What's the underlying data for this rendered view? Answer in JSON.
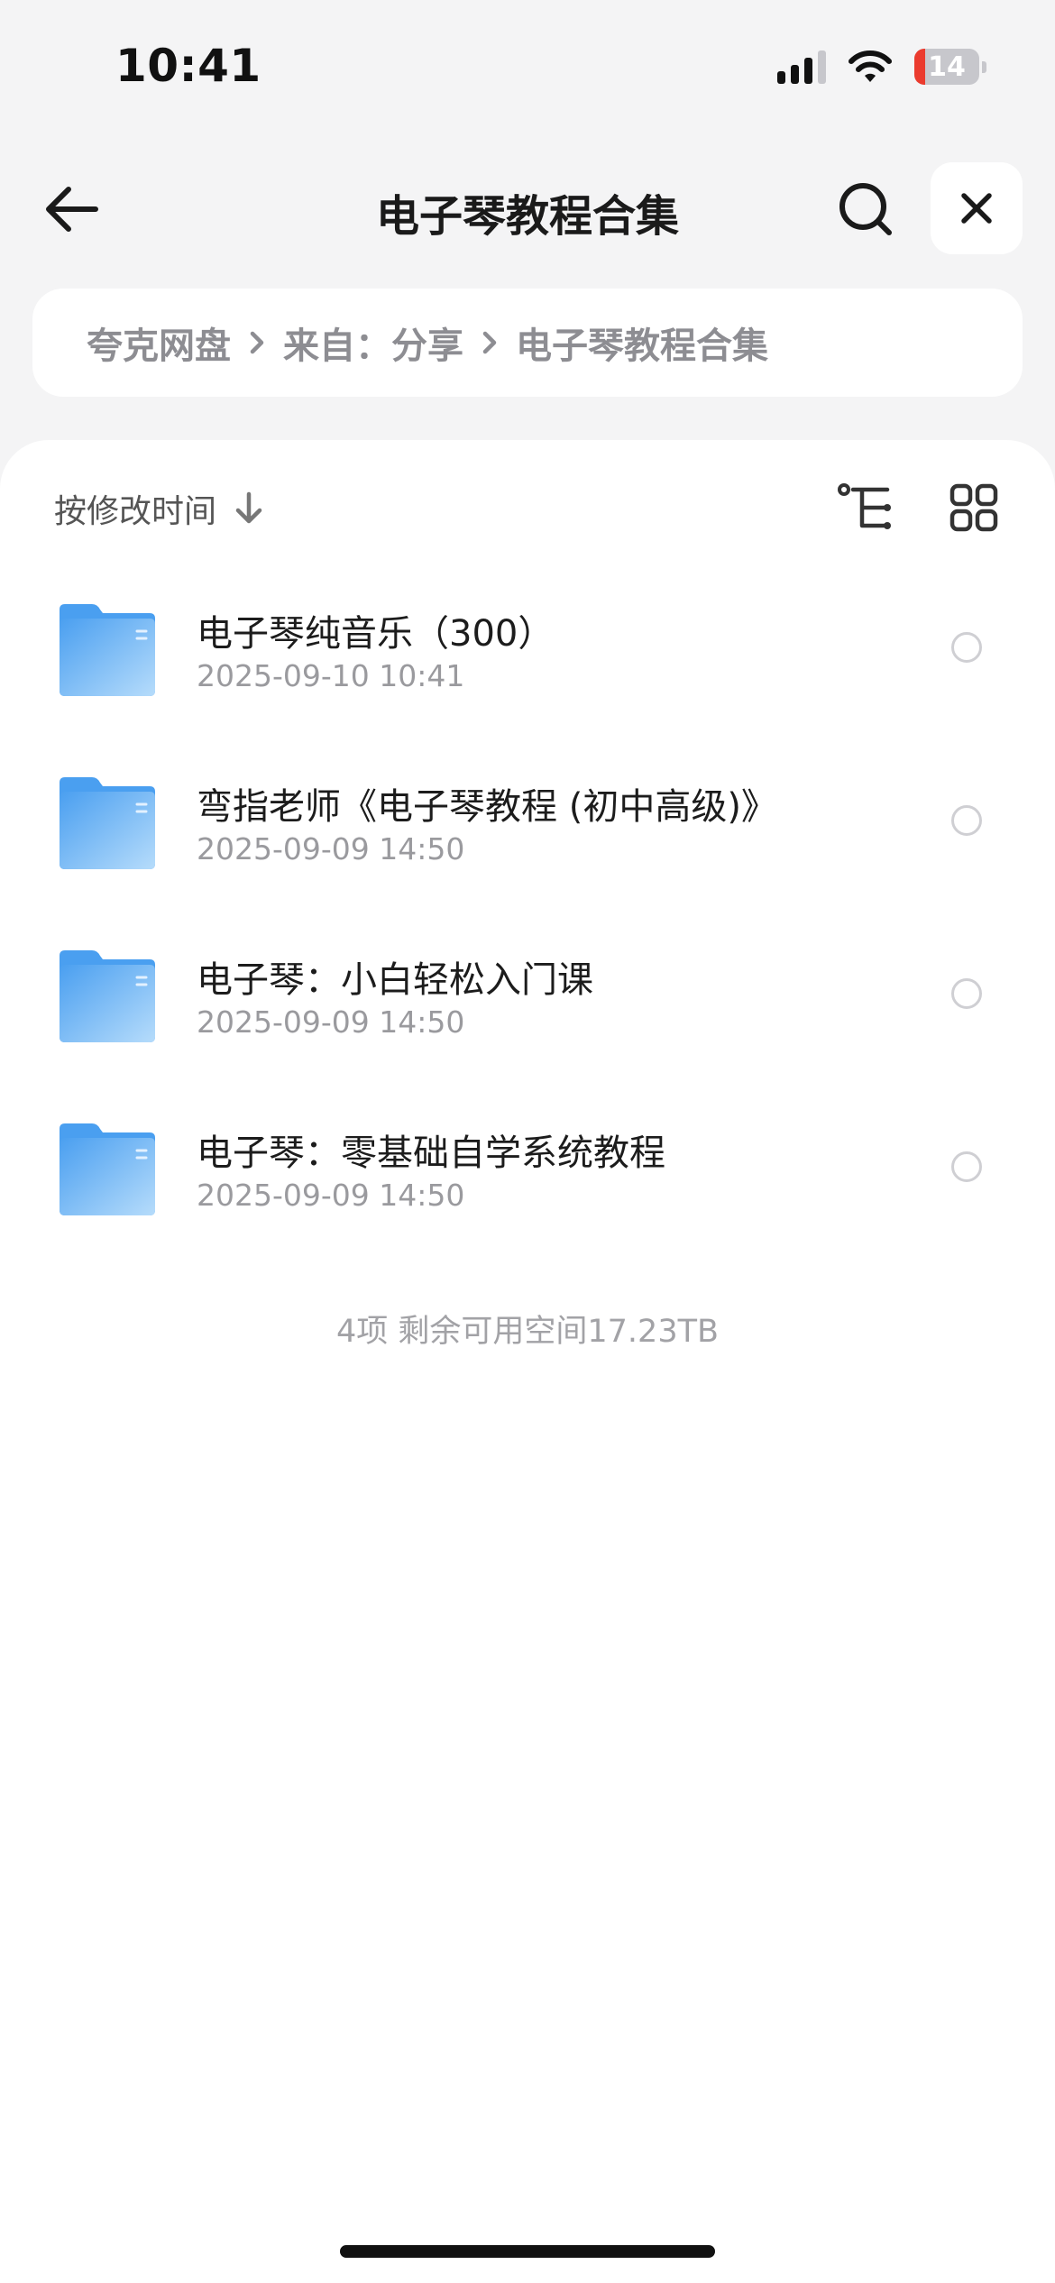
{
  "status_bar": {
    "time": "10:41",
    "battery_level": "14",
    "battery_fill_percent": 16,
    "battery_color": "#eb3b2e"
  },
  "header": {
    "title": "电子琴教程合集",
    "back_icon": "arrow-left-icon",
    "search_icon": "search-icon",
    "close_icon": "close-icon"
  },
  "breadcrumb": {
    "items": [
      "夸克网盘",
      "来自：分享",
      "电子琴教程合集"
    ],
    "separator_icon": "chevron-right-icon"
  },
  "toolbar": {
    "sort_label": "按修改时间",
    "sort_icon": "arrow-down-icon",
    "tree_icon": "tree-view-icon",
    "grid_icon": "grid-view-icon"
  },
  "files": [
    {
      "name": "电子琴纯音乐（300）",
      "date": "2025-09-10 10:41",
      "icon": "folder-icon"
    },
    {
      "name": "弯指老师《电子琴教程 (初中高级)》",
      "date": "2025-09-09 14:50",
      "icon": "folder-icon"
    },
    {
      "name": "电子琴：小白轻松入门课",
      "date": "2025-09-09 14:50",
      "icon": "folder-icon"
    },
    {
      "name": "电子琴：零基础自学系统教程",
      "date": "2025-09-09 14:50",
      "icon": "folder-icon"
    }
  ],
  "footer": {
    "summary": "4项 剩余可用空间17.23TB"
  },
  "colors": {
    "background": "#f4f4f5",
    "card": "#ffffff",
    "folder_blue": "#5aa9f0"
  }
}
